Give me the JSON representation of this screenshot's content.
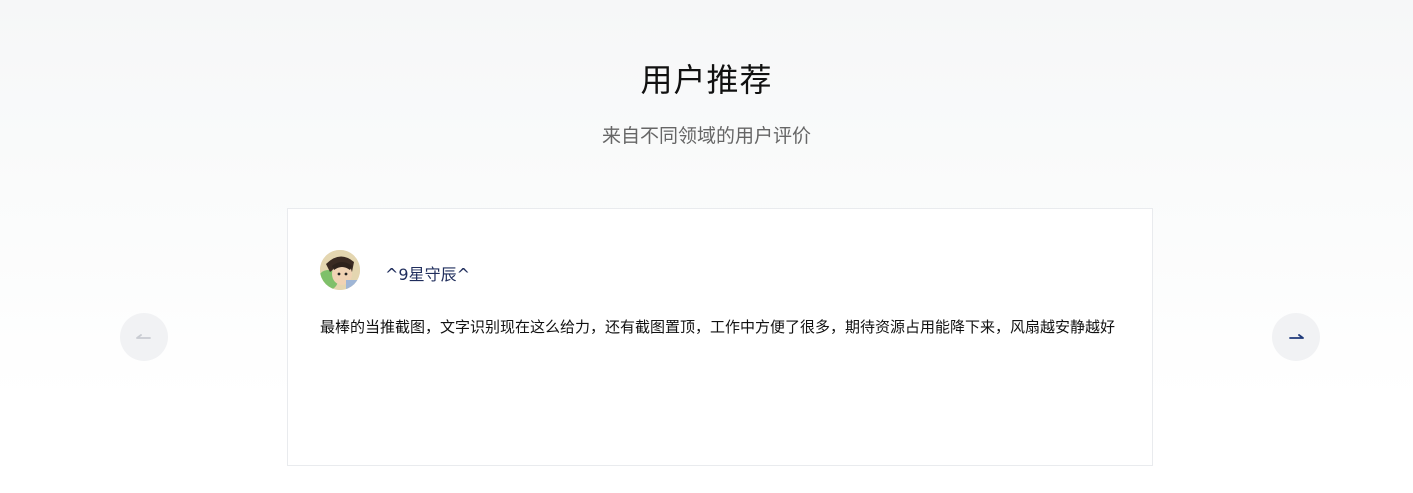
{
  "section": {
    "title": "用户推荐",
    "subtitle": "来自不同领域的用户评价"
  },
  "testimonial": {
    "username": "^9星守辰^",
    "review": "最棒的当推截图，文字识别现在这么给力，还有截图置顶，工作中方便了很多，期待资源占用能降下来，风扇越安静越好"
  },
  "navigation": {
    "prev_icon": "arrow-left-icon",
    "next_icon": "arrow-right-icon",
    "prev_color": "#c9ccd2",
    "next_color": "#1f3a7a"
  }
}
